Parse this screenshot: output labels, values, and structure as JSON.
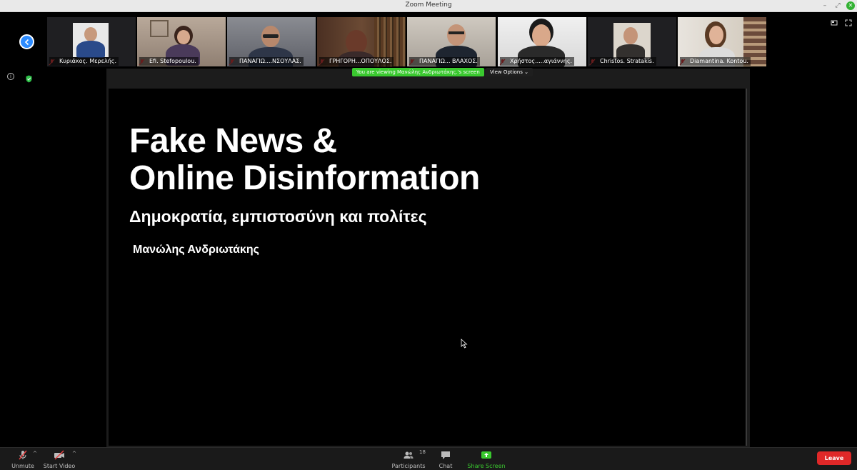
{
  "window": {
    "title": "Zoom Meeting",
    "minimize": "–",
    "restore": "⤢",
    "close": "✕"
  },
  "participants_strip": [
    {
      "name": "Κυριάκος. Μερελής."
    },
    {
      "name": "Efi. Stefopoulou."
    },
    {
      "name": "ΠΑΝΑΓΙΩ....ΝΣΟΥΛΑΣ."
    },
    {
      "name": "ΓΡΗΓΟΡΗ...ΟΠΟΥΛΟΣ."
    },
    {
      "name": "ΠΑΝΑΓΙΩ... ΒΛΑΧΟΣ."
    },
    {
      "name": "Χρήστος.....αγιάννης."
    },
    {
      "name": "Christos. Stratakis."
    },
    {
      "name": "Diamantina. Kontou."
    }
  ],
  "share": {
    "viewing_banner": "You are viewing Μανώλης Ανδριωτάκης.'s screen",
    "view_options": "View Options"
  },
  "slide": {
    "title_line1": "Fake News &",
    "title_line2": "Online Disinformation",
    "subtitle": "Δημοκρατία, εμπιστοσύνη και πολίτες",
    "author": "Μανώλης Ανδριωτάκης"
  },
  "toolbar": {
    "unmute": "Unmute",
    "start_video": "Start Video",
    "participants": "Participants",
    "participants_count": "18",
    "chat": "Chat",
    "share_screen": "Share Screen",
    "leave": "Leave"
  },
  "colors": {
    "accent_blue": "#2d8cff",
    "share_green": "#3ac92f",
    "leave_red": "#e02828",
    "muted_red": "#e34040"
  },
  "icons": [
    "back-arrow-icon",
    "info-icon",
    "encryption-shield-icon",
    "mic-muted-icon",
    "video-off-icon",
    "participants-icon",
    "chat-icon",
    "share-screen-icon",
    "speaker-view-icon",
    "fullscreen-icon",
    "mouse-cursor-icon"
  ]
}
